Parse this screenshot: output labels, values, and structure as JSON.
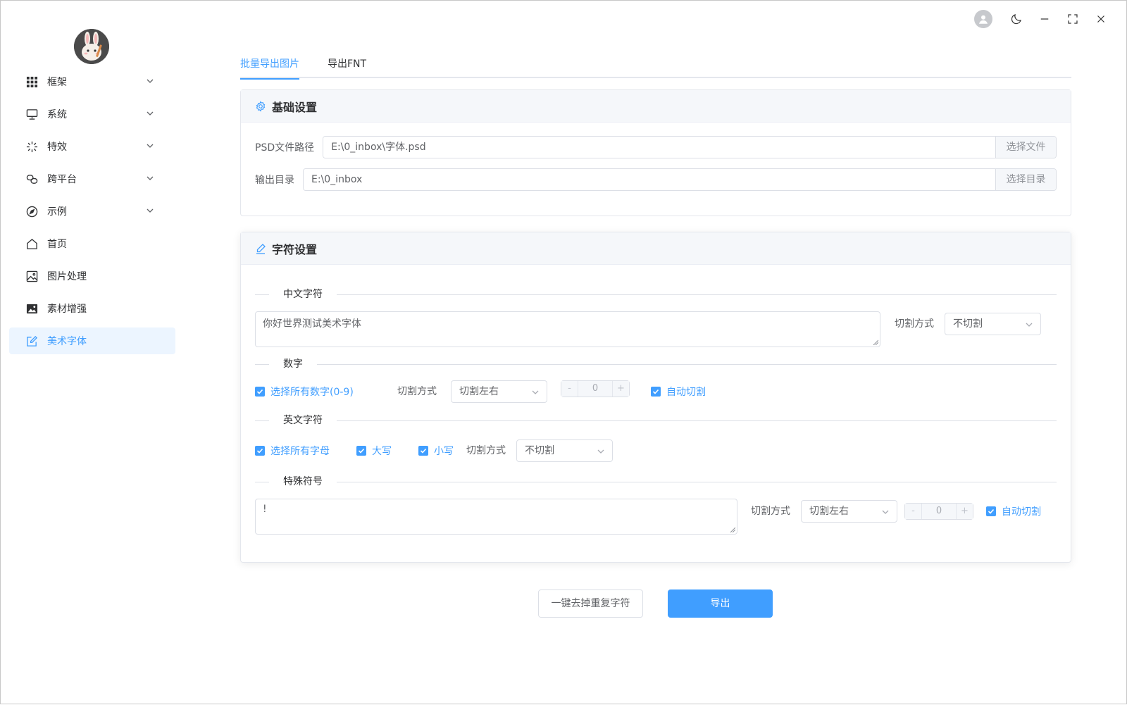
{
  "sidebar": {
    "logo_icon": "bunny-avatar-icon",
    "items": [
      {
        "label": "框架",
        "icon": "grid-icon",
        "has_children": true
      },
      {
        "label": "系统",
        "icon": "monitor-icon",
        "has_children": true
      },
      {
        "label": "特效",
        "icon": "loading-icon",
        "has_children": true
      },
      {
        "label": "跨平台",
        "icon": "link-icon",
        "has_children": true
      },
      {
        "label": "示例",
        "icon": "compass-icon",
        "has_children": true
      },
      {
        "label": "首页",
        "icon": "home-icon",
        "has_children": false
      },
      {
        "label": "图片处理",
        "icon": "picture-icon",
        "has_children": false
      },
      {
        "label": "素材增强",
        "icon": "picture-filled-icon",
        "has_children": false
      },
      {
        "label": "美术字体",
        "icon": "edit-icon",
        "has_children": false,
        "active": true
      }
    ]
  },
  "titlebar": {
    "icons": [
      "user-avatar-icon",
      "moon-icon",
      "minimize-icon",
      "maximize-icon",
      "close-icon"
    ]
  },
  "tabs": [
    {
      "label": "批量导出图片",
      "active": true
    },
    {
      "label": "导出FNT",
      "active": false
    }
  ],
  "basic": {
    "title": "基础设置",
    "psd_label": "PSD文件路径",
    "psd_value": "E:\\0_inbox\\字体.psd",
    "psd_button": "选择文件",
    "out_label": "输出目录",
    "out_value": "E:\\0_inbox",
    "out_button": "选择目录"
  },
  "chars": {
    "title": "字符设置",
    "chinese": {
      "section": "中文字符",
      "text": "你好世界测试美术字体",
      "cut_label": "切割方式",
      "cut_value": "不切割"
    },
    "digits": {
      "section": "数字",
      "select_all": "选择所有数字(0-9)",
      "cut_label": "切割方式",
      "cut_value": "切割左右",
      "stepper_value": "0",
      "minus": "-",
      "plus": "+",
      "auto_cut": "自动切割"
    },
    "english": {
      "section": "英文字符",
      "select_all": "选择所有字母",
      "upper": "大写",
      "lower": "小写",
      "cut_label": "切割方式",
      "cut_value": "不切割"
    },
    "special": {
      "section": "特殊符号",
      "text": "!",
      "cut_label": "切割方式",
      "cut_value": "切割左右",
      "stepper_value": "0",
      "minus": "-",
      "plus": "+",
      "auto_cut": "自动切割"
    }
  },
  "actions": {
    "dedupe": "一键去掉重复字符",
    "export": "导出"
  },
  "colors": {
    "accent": "#409eff",
    "active_bg": "#ecf5ff"
  }
}
